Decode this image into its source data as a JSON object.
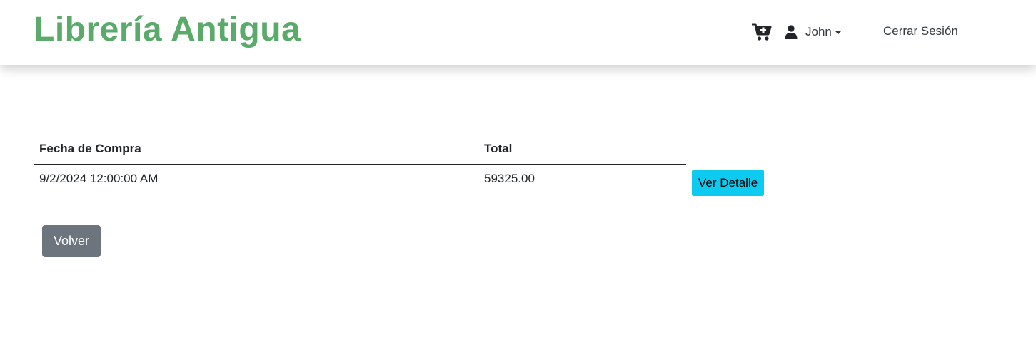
{
  "brand": {
    "title": "Librería Antigua",
    "color": "#5aaa6a"
  },
  "nav": {
    "cart_icon": "cart-plus-icon",
    "user_icon": "user-icon",
    "user_name": "John",
    "logout_label": "Cerrar Sesión"
  },
  "table": {
    "headers": [
      "Fecha de Compra",
      "Total"
    ],
    "rows": [
      {
        "date": "9/2/2024 12:00:00 AM",
        "total": "59325.00",
        "action_label": "Ver Detalle"
      }
    ]
  },
  "back_label": "Volver",
  "colors": {
    "detail_button": "#0dcaf0",
    "back_button": "#6c757d"
  }
}
